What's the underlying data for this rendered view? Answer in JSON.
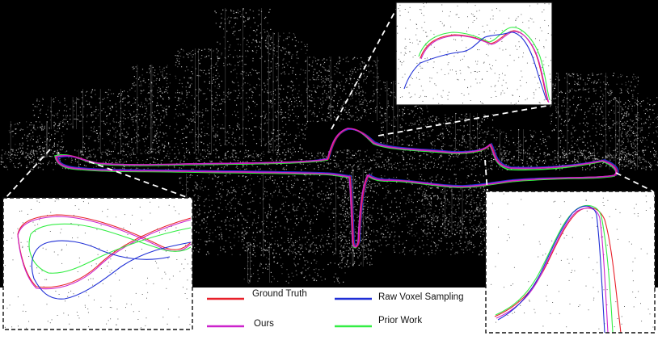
{
  "legend": {
    "items": [
      {
        "label": "Ground Truth",
        "color": "#e8202a"
      },
      {
        "label": "Raw Voxel Sampling",
        "color": "#1f2fd6"
      },
      {
        "label": "Ours",
        "color": "#cc22cc"
      },
      {
        "label": "Prior Work",
        "color": "#33ee44"
      }
    ]
  },
  "colors": {
    "background": "#000000",
    "points": "#d8d8d8",
    "inset_bg": "#ffffff",
    "inset_points": "#222222",
    "connector": "#ffffff"
  },
  "insets": [
    {
      "name": "inset-top-right",
      "border": "solid"
    },
    {
      "name": "inset-bottom-left",
      "border": "dashed"
    },
    {
      "name": "inset-bottom-right",
      "border": "dashed"
    }
  ]
}
